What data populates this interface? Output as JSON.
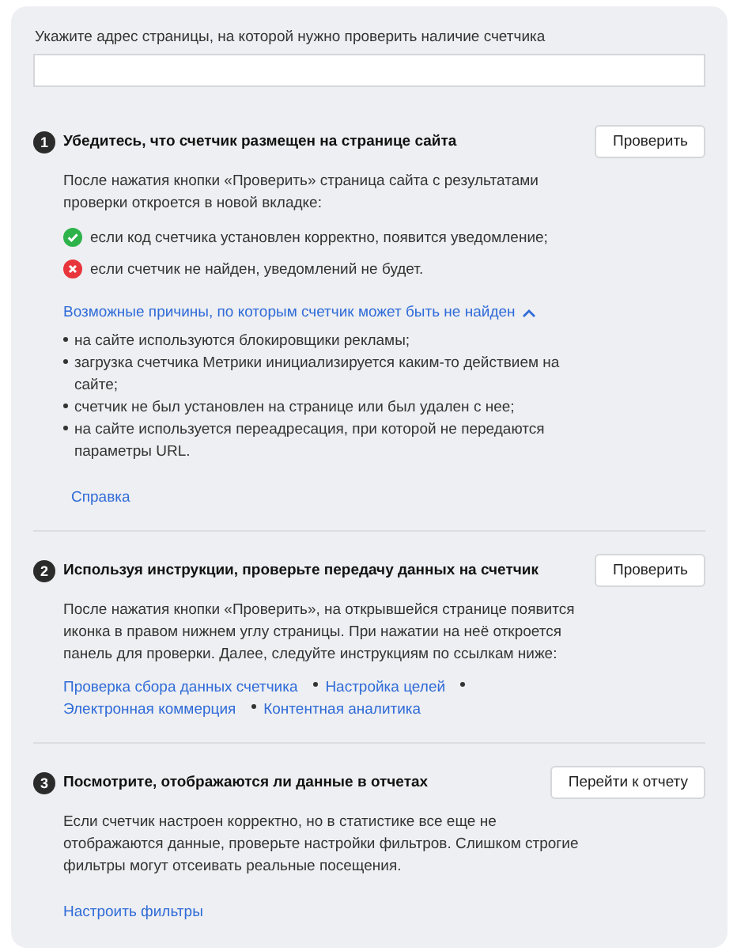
{
  "url_field": {
    "label": "Укажите адрес страницы, на которой нужно проверить наличие счетчика"
  },
  "steps": [
    {
      "number": "1",
      "title": "Убедитесь, что счетчик размещен на странице сайта",
      "button": "Проверить",
      "text": "После нажатия кнопки «Проверить» страница сайта с результатами проверки откроется в новой вкладке:",
      "checks": [
        {
          "kind": "success",
          "text": "если код счетчика установлен корректно, появится уведомление;"
        },
        {
          "kind": "error",
          "text": "если счетчик не найден, уведомлений не будет."
        }
      ],
      "reasons": {
        "toggle": "Возможные причины, по которым счетчик может быть не найден",
        "expanded": true,
        "items": [
          "на сайте используются блокировщики рекламы;",
          "загрузка счетчика Метрики инициализируется каким-то действием на сайте;",
          "счетчик не был установлен на странице или был удален с нее;",
          "на сайте используется переадресация, при которой не передаются параметры URL."
        ]
      },
      "links": [
        "Справка"
      ]
    },
    {
      "number": "2",
      "title": "Используя инструкции, проверьте передачу данных на счетчик",
      "button": "Проверить",
      "text": "После нажатия кнопки «Проверить», на открывшейся странице появится иконка в правом нижнем углу страницы. При нажатии на неё откроется панель для проверки. Далее, следуйте инструкциям по ссылкам ниже:",
      "links": [
        "Проверка сбора данных счетчика",
        "Настройка целей",
        "Электронная коммерция",
        "Контентная аналитика"
      ]
    },
    {
      "number": "3",
      "title": "Посмотрите, отображаются ли данные в отчетах",
      "button": "Перейти к отчету",
      "text": "Если счетчик настроен корректно, но в статистике все еще не отображаются данные, проверьте настройки фильтров. Слишком строгие фильтры могут отсеивать реальные посещения.",
      "links": [
        "Настроить фильтры"
      ]
    }
  ]
}
